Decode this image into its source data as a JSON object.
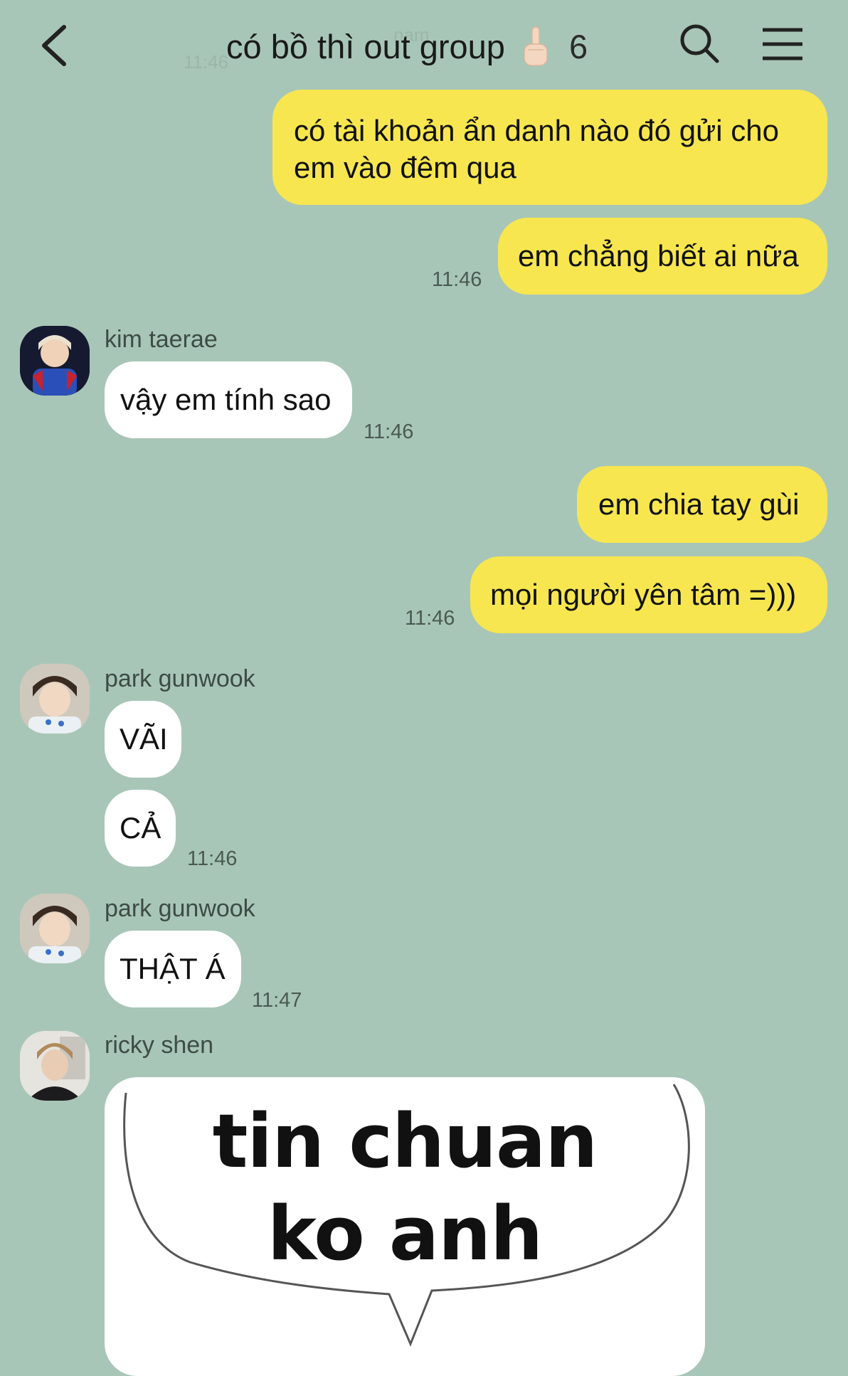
{
  "header": {
    "title": "có bồ thì out group",
    "member_count": "6",
    "faded_name": "nam",
    "faded_time": "11:46",
    "icons": [
      "back-arrow-icon",
      "middle-finger-emoji",
      "search-icon",
      "menu-icon"
    ]
  },
  "messages": {
    "m1": {
      "text": "có tài khoản ẩn danh nào đó gửi cho em vào đêm qua"
    },
    "m2": {
      "text": "em chẳng biết ai nữa",
      "time": "11:46"
    },
    "m3": {
      "sender": "kim taerae",
      "text": "vậy em tính sao",
      "time": "11:46"
    },
    "m4": {
      "text": "em chia tay gùi"
    },
    "m5": {
      "text": "mọi người yên tâm =)))",
      "time": "11:46"
    },
    "m6": {
      "sender": "park gunwook",
      "text": "VÃI"
    },
    "m7": {
      "text": "CẢ",
      "time": "11:46"
    },
    "m8": {
      "sender": "park gunwook",
      "text": "THẬT Á",
      "time": "11:47"
    },
    "m9": {
      "sender": "ricky shen",
      "sticker_line1": "tin chuan",
      "sticker_line2": "ko anh"
    }
  },
  "colors": {
    "background": "#a8c6b7",
    "my_bubble": "#f7e64f",
    "their_bubble": "#ffffff"
  }
}
